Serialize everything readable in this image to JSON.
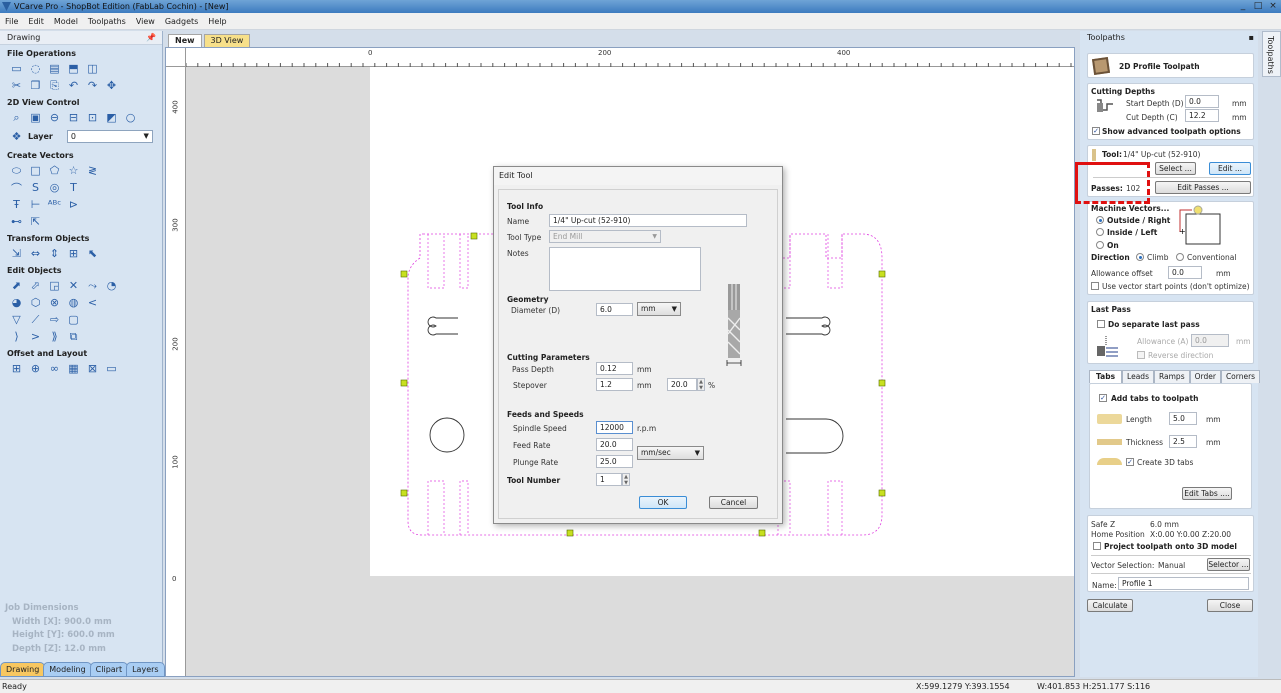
{
  "window": {
    "title": "VCarve Pro - ShopBot Edition (FabLab Cochin) - [New]",
    "controls": [
      "_",
      "□",
      "×"
    ]
  },
  "menu": [
    "File",
    "Edit",
    "Model",
    "Toolpaths",
    "View",
    "Gadgets",
    "Help"
  ],
  "left_panel": {
    "title": "Drawing",
    "sections": [
      {
        "title": "File Operations",
        "rows": [
          [
            "new-file-icon",
            "open-file-icon",
            "save-icon",
            "import-icon",
            "open-folder-icon"
          ],
          [
            "select-all-icon",
            "cut-icon",
            "copy-icon",
            "paste-icon",
            "undo-icon",
            "redo-icon"
          ]
        ]
      },
      {
        "title": "2D View Control",
        "rows": [
          [
            "zoom-extents-icon",
            "zoom-box-icon",
            "zoom-job-icon",
            "zoom-out-icon",
            "view-split-icon",
            "view-2d-icon",
            "view-3d-icon"
          ]
        ]
      },
      {
        "title": "Create Vectors",
        "rows": [
          [
            "circle-icon",
            "ellipse-icon",
            "rectangle-icon",
            "polygon-icon",
            "star-icon"
          ],
          [
            "polyline-icon",
            "arc-icon",
            "curve-icon",
            "spiral-icon"
          ],
          [
            "text-icon",
            "text-on-curve-icon",
            "dimension-icon",
            "auto-layout-text-icon"
          ],
          [
            "node-edit-icon",
            "measure-icon"
          ]
        ]
      },
      {
        "title": "Transform Objects",
        "rows": [
          [
            "move-icon",
            "set-size-icon",
            "rotate-icon",
            "mirror-icon",
            "align-icon"
          ]
        ]
      },
      {
        "title": "Edit Objects",
        "rows": [
          [
            "select-icon",
            "node-edit-tool-icon",
            "interactive-icon",
            "group-icon",
            "ungroup-icon",
            "trim-icon"
          ],
          [
            "weld-icon",
            "subtract-icon",
            "intersect-icon",
            "join-icon",
            "close-vector-icon"
          ],
          [
            "fillet-icon",
            "corner-icon",
            "extend-icon",
            "offset-arrow-icon"
          ],
          [
            "smooth-icon",
            "curve-fit-icon",
            "bezier-icon",
            "split-icon"
          ]
        ]
      },
      {
        "title": "Offset and Layout",
        "rows": [
          [
            "offset-icon",
            "nesting-icon",
            "array-icon",
            "copy-along-icon",
            "create-grid-icon",
            "create-array-icon"
          ]
        ]
      }
    ],
    "layer": {
      "label": "Layer",
      "value": "0"
    },
    "job_dimensions": {
      "title": "Job Dimensions",
      "width": "Width  [X]: 900.0 mm",
      "height": "Height [Y]: 600.0 mm",
      "depth": "Depth  [Z]: 12.0 mm"
    },
    "tabs": [
      {
        "label": "Drawing",
        "active": true
      },
      {
        "label": "Modeling"
      },
      {
        "label": "Clipart"
      },
      {
        "label": "Layers"
      }
    ]
  },
  "doc_tabs": [
    "New",
    "3D View"
  ],
  "rulers": {
    "top": [
      "0",
      "200",
      "400"
    ],
    "left": [
      "400",
      "300",
      "200",
      "100",
      "0"
    ]
  },
  "colors": {
    "toolpath_vector": "#e040e0",
    "tab_marker": "#c8e020",
    "highlight": "#e01010"
  },
  "edit_tool": {
    "title": "Edit Tool",
    "tool_info": "Tool Info",
    "name_label": "Name",
    "name": "1/4\" Up-cut (52-910)",
    "tool_type_label": "Tool Type",
    "tool_type": "End Mill",
    "notes_label": "Notes",
    "notes": "",
    "geometry": "Geometry",
    "diameter_label": "Diameter (D)",
    "diameter": "6.0",
    "diameter_unit": "mm",
    "cutting_params": "Cutting Parameters",
    "pass_depth_label": "Pass Depth",
    "pass_depth": "0.12",
    "pass_depth_unit": "mm",
    "stepover_label": "Stepover",
    "stepover": "1.2",
    "stepover_unit": "mm",
    "stepover_pct": "20.0",
    "pct": "%",
    "feeds": "Feeds and Speeds",
    "spindle_label": "Spindle Speed",
    "spindle": "12000",
    "rpm": "r.p.m",
    "feed_label": "Feed Rate",
    "feed": "20.0",
    "plunge_label": "Plunge Rate",
    "plunge": "25.0",
    "rate_unit": "mm/sec",
    "tool_number_label": "Tool Number",
    "tool_number": "1",
    "ok": "OK",
    "cancel": "Cancel"
  },
  "toolpaths": {
    "title": "Toolpaths",
    "vertical_tab": "Toolpaths",
    "header": "2D Profile Toolpath",
    "cutting_depths": "Cutting Depths",
    "start_label": "Start Depth (D)",
    "start": "0.0",
    "cut_label": "Cut Depth (C)",
    "cut": "12.2",
    "mm": "mm",
    "show_advanced": "Show advanced toolpath options",
    "show_advanced_checked": true,
    "tool_label": "Tool:",
    "tool": "1/4\" Up-cut (52-910)",
    "select": "Select ...",
    "edit": "Edit ...",
    "passes_label": "Passes:",
    "passes": "102",
    "edit_passes": "Edit Passes ...",
    "machine_vectors": "Machine Vectors...",
    "outside": "Outside / Right",
    "inside": "Inside / Left",
    "on": "On",
    "side_selected": "Outside / Right",
    "direction": "Direction",
    "climb": "Climb",
    "conventional": "Conventional",
    "direction_selected": "Climb",
    "allowance_label": "Allowance offset",
    "allowance": "0.0",
    "vector_start": "Use vector start points (don't optimize)",
    "last_pass": "Last Pass",
    "separate_last": "Do separate last pass",
    "last_allowance_label": "Allowance (A)",
    "last_allowance": "0.0",
    "reverse": "Reverse direction",
    "tabs": [
      "Tabs",
      "Leads",
      "Ramps",
      "Order",
      "Corners"
    ],
    "add_tabs": "Add tabs to toolpath",
    "add_tabs_checked": true,
    "length_label": "Length",
    "length": "5.0",
    "thickness_label": "Thickness",
    "thickness": "2.5",
    "create_3d": "Create 3D tabs",
    "create_3d_checked": true,
    "edit_tabs": "Edit Tabs ....",
    "safe_z_label": "Safe Z",
    "safe_z": "6.0 mm",
    "home_label": "Home Position",
    "home": "X:0.00 Y:0.00 Z:20.00",
    "project": "Project toolpath onto 3D model",
    "vector_sel_label": "Vector Selection:",
    "vector_sel": "Manual",
    "selector": "Selector ...",
    "name_label": "Name:",
    "name": "Profile 1",
    "calculate": "Calculate",
    "close": "Close"
  },
  "status": {
    "text": "Ready",
    "coords": "X:599.1279 Y:393.1554",
    "size": "W:401.853  H:251.177  S:116"
  }
}
